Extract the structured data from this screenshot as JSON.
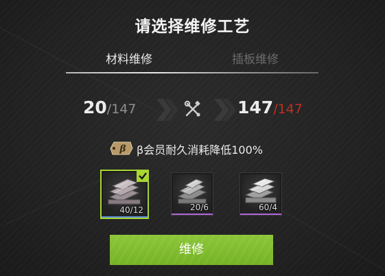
{
  "dialog": {
    "title": "请选择维修工艺"
  },
  "tabs": [
    {
      "label": "材料维修",
      "active": true
    },
    {
      "label": "插板维修",
      "active": false
    }
  ],
  "durability": {
    "current": "20",
    "current_max": "/147",
    "after": "147",
    "after_max": "/147"
  },
  "vip": {
    "badge": "β",
    "text": "β会员耐久消耗降低100%"
  },
  "materials": [
    {
      "quantity": "40/12",
      "selected": true,
      "rarity_color": "#5d8fd4"
    },
    {
      "quantity": "20/6",
      "selected": false,
      "rarity_color": "#b066d8"
    },
    {
      "quantity": "60/4",
      "selected": false,
      "rarity_color": "#b066d8"
    }
  ],
  "repair_button": {
    "label": "维修"
  },
  "colors": {
    "accent_green": "#8cc63a",
    "warning_red": "#c02f22"
  }
}
